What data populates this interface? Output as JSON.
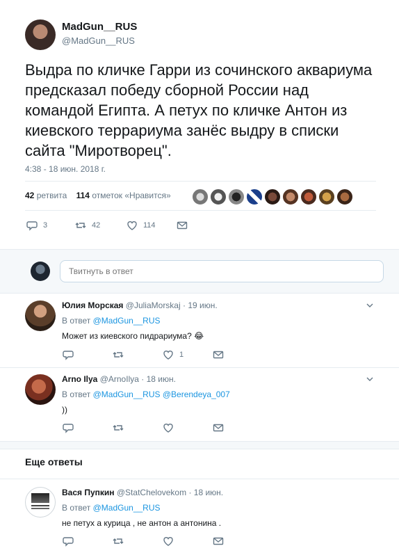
{
  "tweet": {
    "author_name": "MadGun__RUS",
    "author_handle": "@MadGun__RUS",
    "text": "Выдра по кличке Гарри из сочинского аквариума предсказал победу сборной России над командой Египта. А петух по кличке Антон из киевского террариума занёс выдру в списки сайта \"Миротворец\".",
    "timestamp": "4:38 - 18 июн. 2018 г.",
    "stats": {
      "retweets_count": "42",
      "retweets_label": "ретвита",
      "likes_count": "114",
      "likes_label": "отметок «Нравится»"
    },
    "actions": {
      "reply": "3",
      "retweet": "42",
      "like": "114"
    }
  },
  "compose": {
    "placeholder": "Твитнуть в ответ"
  },
  "replies": [
    {
      "name": "Юлия Морская",
      "handle": "@JuliaMorskaj",
      "date": "· 19 июн.",
      "reply_to_label": "В ответ",
      "reply_to": "@MadGun__RUS",
      "reply_to_2": "",
      "text": "Может из киевского пидрариума?",
      "emoji": "😂",
      "likes": "1"
    },
    {
      "name": "Arno Ilya",
      "handle": "@ArnoIlya",
      "date": "· 18 июн.",
      "reply_to_label": "В ответ",
      "reply_to": "@MadGun__RUS",
      "reply_to_2": "@Berendeya_007",
      "text": "))",
      "likes": ""
    }
  ],
  "more_replies_title": "Еще ответы",
  "more_replies": [
    {
      "name": "Вася Пупкин",
      "handle": "@StatChelovekom",
      "date": "· 18 июн.",
      "reply_to_label": "В ответ",
      "reply_to": "@MadGun__RUS",
      "text": "не петух а курица , не антон а антонина ."
    }
  ],
  "colors": {
    "accent": "#1b95e0",
    "muted": "#657786",
    "divider": "#e6ecf0",
    "background_alt": "#f5f8fa"
  }
}
